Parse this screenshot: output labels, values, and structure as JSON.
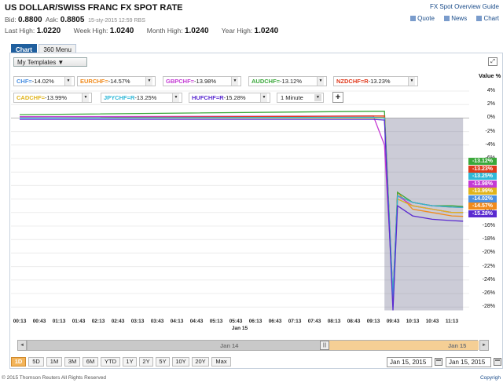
{
  "header": {
    "title": "US DOLLAR/SWISS FRANC FX SPOT RATE",
    "guide_link": "FX Spot Overview Guide",
    "bid_label": "Bid:",
    "bid_value": "0.8800",
    "ask_label": "Ask:",
    "ask_value": "0.8805",
    "timestamp": "15-sty-2015 12:59 RBS",
    "links": [
      "Quote",
      "News",
      "Chart"
    ],
    "highs": [
      {
        "label": "Last High:",
        "value": "1.0220"
      },
      {
        "label": "Week High:",
        "value": "1.0240"
      },
      {
        "label": "Month High:",
        "value": "1.0240"
      },
      {
        "label": "Year High:",
        "value": "1.0240"
      }
    ]
  },
  "tabs": [
    {
      "label": "Chart",
      "active": true
    },
    {
      "label": "360 Menu",
      "active": false
    }
  ],
  "toolbar": {
    "templates_label": "My Templates ▼",
    "expand_icon": "expand-icon",
    "add_label": "+",
    "interval_label": "1 Minute",
    "dropdown_glyph": "▼"
  },
  "pairs": [
    {
      "name": "CHF=",
      "value": "-14.02%",
      "color": "#4a8fe0"
    },
    {
      "name": "EURCHF=",
      "value": "-14.57%",
      "color": "#f08a1c"
    },
    {
      "name": "GBPCHF=",
      "value": "-13.98%",
      "color": "#c43ad4"
    },
    {
      "name": "AUDCHF=",
      "value": "-13.12%",
      "color": "#3aa83a"
    },
    {
      "name": "NZDCHF=R",
      "value": "-13.23%",
      "color": "#e03a1c"
    },
    {
      "name": "CADCHF=",
      "value": "-13.99%",
      "color": "#e0b41c"
    },
    {
      "name": "JPYCHF=R",
      "value": "-13.25%",
      "color": "#2fb8d8"
    },
    {
      "name": "HUFCHF=R",
      "value": "-15.28%",
      "color": "#5a2ad0"
    }
  ],
  "value_axis_label": "Value %",
  "y_ticks": [
    "4%",
    "2%",
    "0%",
    "-2%",
    "-4%",
    "-6%",
    "-8%",
    "-10%",
    "-12%",
    "-14%",
    "-16%",
    "-18%",
    "-20%",
    "-22%",
    "-24%",
    "-26%",
    "-28%"
  ],
  "x_ticks": [
    "00:13",
    "00:43",
    "01:13",
    "01:43",
    "02:13",
    "02:43",
    "03:13",
    "03:43",
    "04:13",
    "04:43",
    "05:13",
    "05:43",
    "06:13",
    "06:43",
    "07:13",
    "07:43",
    "08:13",
    "08:43",
    "09:13",
    "09:43",
    "10:13",
    "10:43",
    "11:13"
  ],
  "x_sub_label": "Jan 15",
  "end_labels": [
    {
      "text": "-13.12%",
      "color": "#3aa83a"
    },
    {
      "text": "-13.23%",
      "color": "#e03a1c"
    },
    {
      "text": "-13.25%",
      "color": "#2fb8d8"
    },
    {
      "text": "-13.98%",
      "color": "#c43ad4"
    },
    {
      "text": "-13.99%",
      "color": "#e0b41c"
    },
    {
      "text": "-14.02%",
      "color": "#4a8fe0"
    },
    {
      "text": "-14.57%",
      "color": "#f08a1c"
    },
    {
      "text": "-15.28%",
      "color": "#5a2ad0"
    }
  ],
  "scroller": {
    "left_label": "Jan 14",
    "right_label": "Jan 15",
    "left_arrow": "◄",
    "right_arrow": "►",
    "handle_glyph": "|||"
  },
  "ranges": [
    {
      "label": "1D",
      "active": true
    },
    {
      "label": "5D",
      "active": false
    },
    {
      "label": "1M",
      "active": false
    },
    {
      "label": "3M",
      "active": false
    },
    {
      "label": "6M",
      "active": false
    },
    {
      "label": "YTD",
      "active": false
    },
    {
      "label": "1Y",
      "active": false
    },
    {
      "label": "2Y",
      "active": false
    },
    {
      "label": "5Y",
      "active": false
    },
    {
      "label": "10Y",
      "active": false
    },
    {
      "label": "20Y",
      "active": false
    },
    {
      "label": "Max",
      "active": false
    }
  ],
  "dates": {
    "from": "Jan 15, 2015",
    "to": "Jan 15, 2015"
  },
  "footer": {
    "copyright": "© 2015 Thomson Reuters All Rights Reserved",
    "right_link": "Copyrigh"
  },
  "chart_data": {
    "type": "line",
    "xlabel": "",
    "ylabel": "Value %",
    "ylim": [
      -29,
      5
    ],
    "x": [
      "00:13",
      "09:13",
      "09:30",
      "09:43",
      "09:50",
      "10:13",
      "10:43",
      "11:13",
      "11:30"
    ],
    "shaded_region": {
      "from": "09:30",
      "to": "11:30"
    },
    "series": [
      {
        "name": "CHF=",
        "color": "#4a8fe0",
        "values": [
          0.0,
          0.0,
          0.0,
          -28.0,
          -12.0,
          -13.0,
          -13.5,
          -14.0,
          -14.02
        ]
      },
      {
        "name": "EURCHF=",
        "color": "#f08a1c",
        "values": [
          0.0,
          0.1,
          0.1,
          -27.0,
          -11.0,
          -13.5,
          -14.0,
          -14.5,
          -14.57
        ]
      },
      {
        "name": "GBPCHF=",
        "color": "#c43ad4",
        "values": [
          0.2,
          0.3,
          -4.0,
          -26.0,
          -11.5,
          -13.0,
          -13.5,
          -14.0,
          -13.98
        ]
      },
      {
        "name": "AUDCHF=",
        "color": "#3aa83a",
        "values": [
          0.5,
          1.0,
          1.0,
          -26.5,
          -11.0,
          -12.5,
          -13.0,
          -13.0,
          -13.12
        ]
      },
      {
        "name": "NZDCHF=R",
        "color": "#e03a1c",
        "values": [
          0.0,
          0.3,
          0.3,
          -27.0,
          -11.5,
          -12.5,
          -13.0,
          -13.2,
          -13.23
        ]
      },
      {
        "name": "CADCHF=",
        "color": "#e0b41c",
        "values": [
          0.0,
          0.0,
          0.0,
          -27.0,
          -12.0,
          -13.0,
          -13.5,
          -14.0,
          -13.99
        ]
      },
      {
        "name": "JPYCHF=R",
        "color": "#2fb8d8",
        "values": [
          0.0,
          0.1,
          0.0,
          -26.5,
          -11.5,
          -12.5,
          -13.0,
          -13.2,
          -13.25
        ]
      },
      {
        "name": "HUFCHF=R",
        "color": "#5a2ad0",
        "values": [
          -0.2,
          -0.2,
          -0.3,
          -28.5,
          -13.0,
          -14.5,
          -15.0,
          -15.2,
          -15.28
        ]
      }
    ]
  }
}
